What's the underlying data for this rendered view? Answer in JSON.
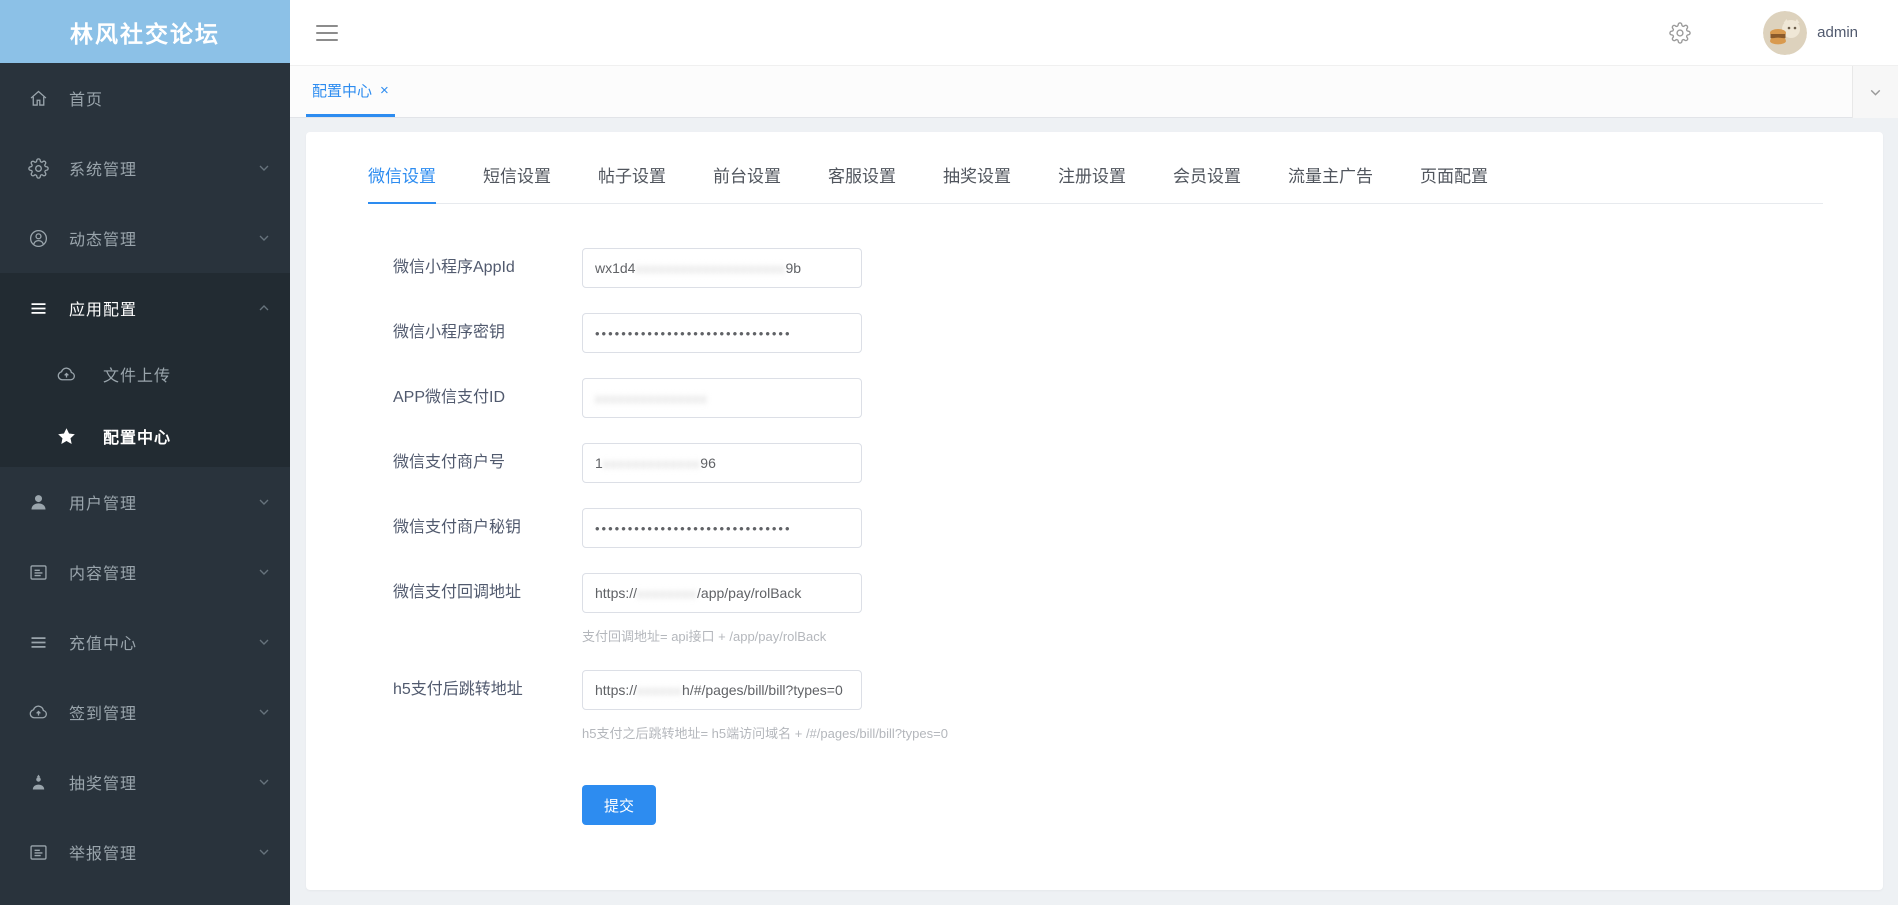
{
  "colors": {
    "primary": "#2d8cf0",
    "logo_bg": "#8cc1e7",
    "sidebar_bg": "#29333c",
    "sidebar_submenu_bg": "#222b32"
  },
  "sidebar": {
    "logo_text": "林风社交论坛",
    "items": [
      {
        "label": "首页",
        "icon": "home-icon",
        "has_children": false
      },
      {
        "label": "系统管理",
        "icon": "gear-icon",
        "has_children": true
      },
      {
        "label": "动态管理",
        "icon": "user-circle-icon",
        "has_children": true
      },
      {
        "label": "应用配置",
        "icon": "menu-lines-icon",
        "has_children": true,
        "expanded": true,
        "active": true,
        "children": [
          {
            "label": "文件上传",
            "icon": "cloud-upload-icon",
            "active": false
          },
          {
            "label": "配置中心",
            "icon": "star-icon",
            "active": true
          }
        ]
      },
      {
        "label": "用户管理",
        "icon": "user-icon",
        "has_children": true
      },
      {
        "label": "内容管理",
        "icon": "content-frame-icon",
        "has_children": true
      },
      {
        "label": "充值中心",
        "icon": "list-icon",
        "has_children": true
      },
      {
        "label": "签到管理",
        "icon": "cloud-upload-icon",
        "has_children": true
      },
      {
        "label": "抽奖管理",
        "icon": "prize-user-icon",
        "has_children": true
      },
      {
        "label": "举报管理",
        "icon": "report-frame-icon",
        "has_children": true
      }
    ]
  },
  "topbar": {
    "username": "admin"
  },
  "tabbar": {
    "active_tab": "配置中心",
    "close_label": "×"
  },
  "content": {
    "tabs": [
      "微信设置",
      "短信设置",
      "帖子设置",
      "前台设置",
      "客服设置",
      "抽奖设置",
      "注册设置",
      "会员设置",
      "流量主广告",
      "页面配置"
    ],
    "active_tab": "微信设置",
    "form": {
      "fields": [
        {
          "label": "微信小程序AppId",
          "parts": [
            {
              "text": "wx1d4"
            },
            {
              "text": "xxxxxxxxxxxxxxxxxxxx",
              "redacted": true
            },
            {
              "text": "9b"
            }
          ]
        },
        {
          "label": "微信小程序密钥",
          "parts": [
            {
              "text": "••••••••••••••••••••••••••••••"
            }
          ],
          "masked": true
        },
        {
          "label": "APP微信支付ID",
          "parts": [
            {
              "text": "xxxxxxxxxxxxxxx",
              "redacted": true
            }
          ]
        },
        {
          "label": "微信支付商户号",
          "parts": [
            {
              "text": "1"
            },
            {
              "text": "xxxxxxxxxxxxx",
              "redacted": true
            },
            {
              "text": "96"
            }
          ]
        },
        {
          "label": "微信支付商户秘钥",
          "parts": [
            {
              "text": "••••••••••••••••••••••••••••••"
            }
          ],
          "masked": true
        },
        {
          "label": "微信支付回调地址",
          "parts": [
            {
              "text": "https://"
            },
            {
              "text": "xxxxxxxx",
              "redacted": true
            },
            {
              "text": "/app/pay/rolBack"
            }
          ],
          "hint": "支付回调地址= api接口 + /app/pay/rolBack"
        },
        {
          "label": "h5支付后跳转地址",
          "parts": [
            {
              "text": "https://"
            },
            {
              "text": "xxxxxx",
              "redacted": true
            },
            {
              "text": "h/#/pages/bill/bill?types=0"
            }
          ],
          "hint": "h5支付之后跳转地址= h5端访问域名 + /#/pages/bill/bill?types=0"
        }
      ],
      "submit_label": "提交"
    }
  }
}
